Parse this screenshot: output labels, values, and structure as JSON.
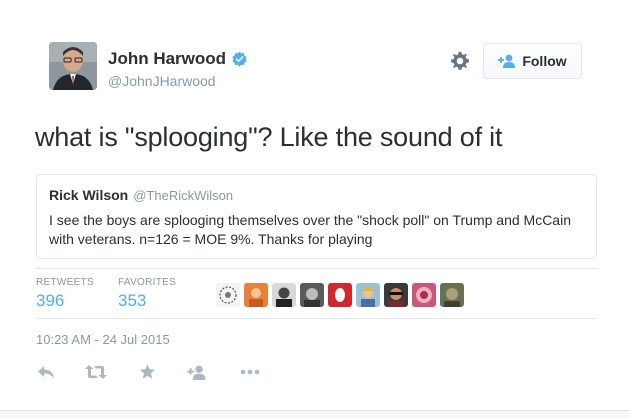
{
  "author": {
    "name": "John Harwood",
    "handle": "@JohnJHarwood",
    "verified": true
  },
  "header": {
    "follow_label": "Follow",
    "settings_icon": "gear-icon",
    "follow_icon": "add-user-icon"
  },
  "tweet": {
    "text": "what is \"splooging\"? Like the sound of it",
    "timestamp": "10:23 AM - 24 Jul 2015"
  },
  "quoted": {
    "name": "Rick Wilson",
    "handle": "@TheRickWilson",
    "text": "I see the boys are splooging themselves over the \"shock poll\" on Trump and McCain with veterans. n=126 = MOE 9%. Thanks for playing"
  },
  "stats": {
    "retweets_label": "RETWEETS",
    "retweets_value": "396",
    "favorites_label": "FAVORITES",
    "favorites_value": "353"
  },
  "favoriters": [
    "avatar-1",
    "avatar-2",
    "avatar-3",
    "avatar-4",
    "avatar-5",
    "avatar-6",
    "avatar-7",
    "avatar-8",
    "avatar-9"
  ],
  "actions": [
    "reply-icon",
    "retweet-icon",
    "favorite-icon",
    "follow-icon",
    "more-icon"
  ],
  "colors": {
    "link_blue": "#55acee",
    "verified_blue": "#55acee",
    "muted": "#8899a6",
    "text": "#292f33",
    "border": "#e1e8ed"
  }
}
